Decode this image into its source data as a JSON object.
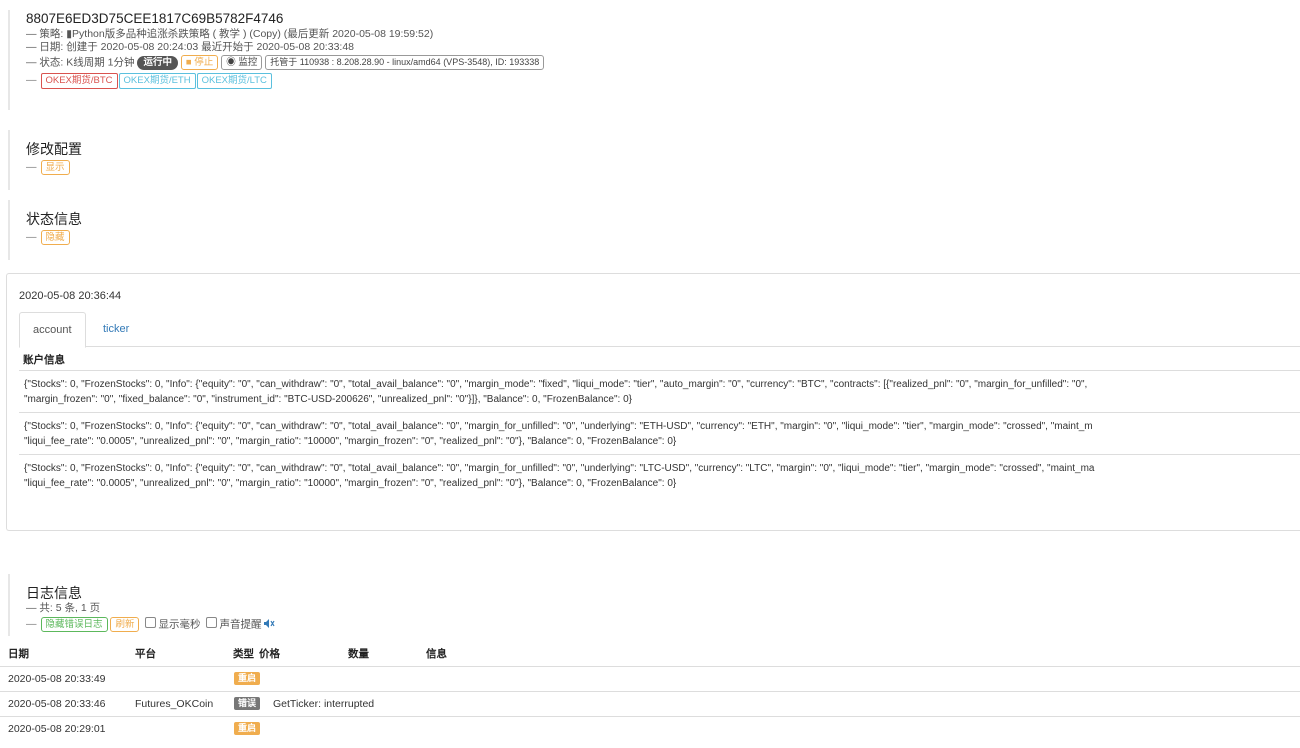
{
  "robot": {
    "id": "8807E6ED3D75CEE1817C69B5782F4746",
    "strategy_line": "— 策略: ▮Python版多品种追涨杀跌策略 ( 教学 ) (Copy) (最后更新 2020-05-08 19:59:52)",
    "date_line": "— 日期: 创建于 2020-05-08 20:24:03 最近开始于 2020-05-08 20:33:48",
    "status_prefix": "— 状态: K线周期 1分钟",
    "status_badge": "运行中",
    "stop_label": "■ 停止",
    "monitor_label": "◉ 监控",
    "host_info": "托管于 110938 : 8.208.28.90 - linux/amd64 (VPS-3548), ID: 193338",
    "exchanges": [
      "OKEX期货/BTC",
      "OKEX期货/ETH",
      "OKEX期货/LTC"
    ]
  },
  "config_section": {
    "title": "修改配置",
    "toggle_label": "显示"
  },
  "status_section": {
    "title": "状态信息",
    "toggle_label": "隐藏"
  },
  "status_panel": {
    "timestamp": "2020-05-08 20:36:44",
    "tabs": [
      "account",
      "ticker"
    ],
    "table_header": "账户信息",
    "rows": [
      {
        "line1": "{\"Stocks\": 0, \"FrozenStocks\": 0, \"Info\": {\"equity\": \"0\", \"can_withdraw\": \"0\", \"total_avail_balance\": \"0\", \"margin_mode\": \"fixed\", \"liqui_mode\": \"tier\", \"auto_margin\": \"0\", \"currency\": \"BTC\", \"contracts\": [{\"realized_pnl\": \"0\", \"margin_for_unfilled\": \"0\",",
        "line2": "\"margin_frozen\": \"0\", \"fixed_balance\": \"0\", \"instrument_id\": \"BTC-USD-200626\", \"unrealized_pnl\": \"0\"}]}, \"Balance\": 0, \"FrozenBalance\": 0}"
      },
      {
        "line1": "{\"Stocks\": 0, \"FrozenStocks\": 0, \"Info\": {\"equity\": \"0\", \"can_withdraw\": \"0\", \"total_avail_balance\": \"0\", \"margin_for_unfilled\": \"0\", \"underlying\": \"ETH-USD\", \"currency\": \"ETH\", \"margin\": \"0\", \"liqui_mode\": \"tier\", \"margin_mode\": \"crossed\", \"maint_m",
        "line2": "\"liqui_fee_rate\": \"0.0005\", \"unrealized_pnl\": \"0\", \"margin_ratio\": \"10000\", \"margin_frozen\": \"0\", \"realized_pnl\": \"0\"}, \"Balance\": 0, \"FrozenBalance\": 0}"
      },
      {
        "line1": "{\"Stocks\": 0, \"FrozenStocks\": 0, \"Info\": {\"equity\": \"0\", \"can_withdraw\": \"0\", \"total_avail_balance\": \"0\", \"margin_for_unfilled\": \"0\", \"underlying\": \"LTC-USD\", \"currency\": \"LTC\", \"margin\": \"0\", \"liqui_mode\": \"tier\", \"margin_mode\": \"crossed\", \"maint_ma",
        "line2": "\"liqui_fee_rate\": \"0.0005\", \"unrealized_pnl\": \"0\", \"margin_ratio\": \"10000\", \"margin_frozen\": \"0\", \"realized_pnl\": \"0\"}, \"Balance\": 0, \"FrozenBalance\": 0}"
      }
    ]
  },
  "log_section": {
    "title": "日志信息",
    "summary": "— 共: 5 条, 1 页",
    "hide_errors_label": "隐藏错误日志",
    "refresh_label": "刷新",
    "show_ms_label": "显示毫秒",
    "sound_label": "声音提醒",
    "columns": [
      "日期",
      "平台",
      "类型",
      "价格",
      "数量",
      "信息"
    ],
    "rows": [
      {
        "date": "2020-05-08 20:33:49",
        "platform": "",
        "type": "重启",
        "type_color": "#f0ad4e",
        "info": ""
      },
      {
        "date": "2020-05-08 20:33:46",
        "platform": "Futures_OKCoin",
        "type": "错误",
        "type_color": "#777777",
        "info": "GetTicker: interrupted"
      },
      {
        "date": "2020-05-08 20:29:01",
        "platform": "",
        "type": "重启",
        "type_color": "#f0ad4e",
        "info": ""
      }
    ]
  },
  "colors": {
    "accent": "#337ab7",
    "warning": "#f0ad4e",
    "success": "#5cb85c",
    "danger": "#d9534f",
    "info": "#5bc0de"
  }
}
